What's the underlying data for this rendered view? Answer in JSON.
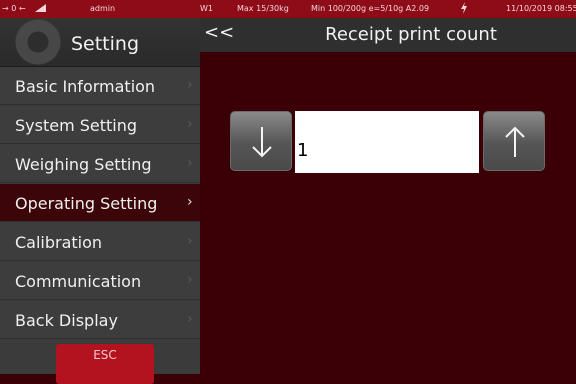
{
  "status_bar": {
    "indicators": "→ 0 ←",
    "user": "admin",
    "scale_id": "W1",
    "capacity": "Max 15/30kg",
    "spec": "Min 100/200g e=5/10g A2.09",
    "datetime": "11/10/2019 08:55",
    "power_icon": "lightning-icon"
  },
  "sidebar": {
    "title": "Setting",
    "items": [
      {
        "label": "Basic Information",
        "active": false
      },
      {
        "label": "System Setting",
        "active": false
      },
      {
        "label": "Weighing Setting",
        "active": false
      },
      {
        "label": "Operating Setting",
        "active": true
      },
      {
        "label": "Calibration",
        "active": false
      },
      {
        "label": "Communication",
        "active": false
      },
      {
        "label": "Back Display",
        "active": false
      }
    ],
    "chevron": "›",
    "esc_label": "ESC"
  },
  "main": {
    "back_label": "<<",
    "title": "Receipt print count",
    "value": "1",
    "decrement_icon": "arrow-down-icon",
    "increment_icon": "arrow-up-icon"
  },
  "colors": {
    "status_bar": "#8e0b18",
    "background": "#3a0006",
    "sidebar": "#3d3d3d",
    "active_item": "#3c0509",
    "esc_button": "#b3121f"
  }
}
